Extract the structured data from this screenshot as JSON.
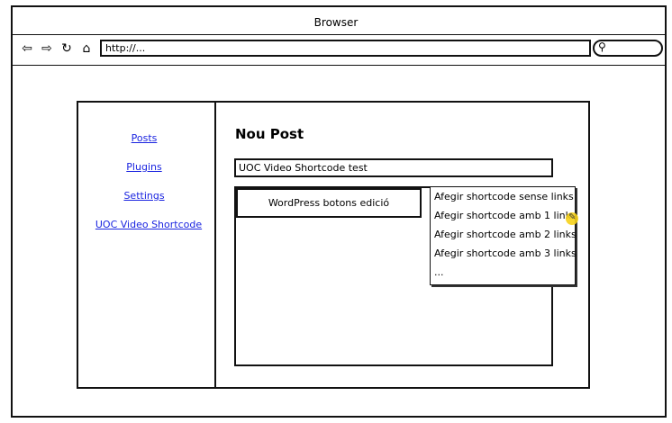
{
  "browser": {
    "title": "Browser",
    "url": "http://...",
    "nav_icons": [
      "back-icon",
      "forward-icon",
      "reload-icon",
      "home-icon"
    ]
  },
  "sidebar": {
    "items": [
      {
        "label": "Posts"
      },
      {
        "label": "Plugins"
      },
      {
        "label": "Settings"
      },
      {
        "label": "UOC Video Shortcode"
      }
    ]
  },
  "main": {
    "heading": "Nou Post",
    "title_input_value": "UOC Video Shortcode test",
    "editor_button_label": "WordPress botons edició"
  },
  "dropdown": {
    "items": [
      "Afegir shortcode sense links",
      "Afegir shortcode amb 1 link",
      "Afegir shortcode amb 2 links",
      "Afegir shortcode amb 3 links",
      "..."
    ]
  },
  "colors": {
    "link": "#1a24e0",
    "cursor_highlight": "#f6d21a"
  }
}
